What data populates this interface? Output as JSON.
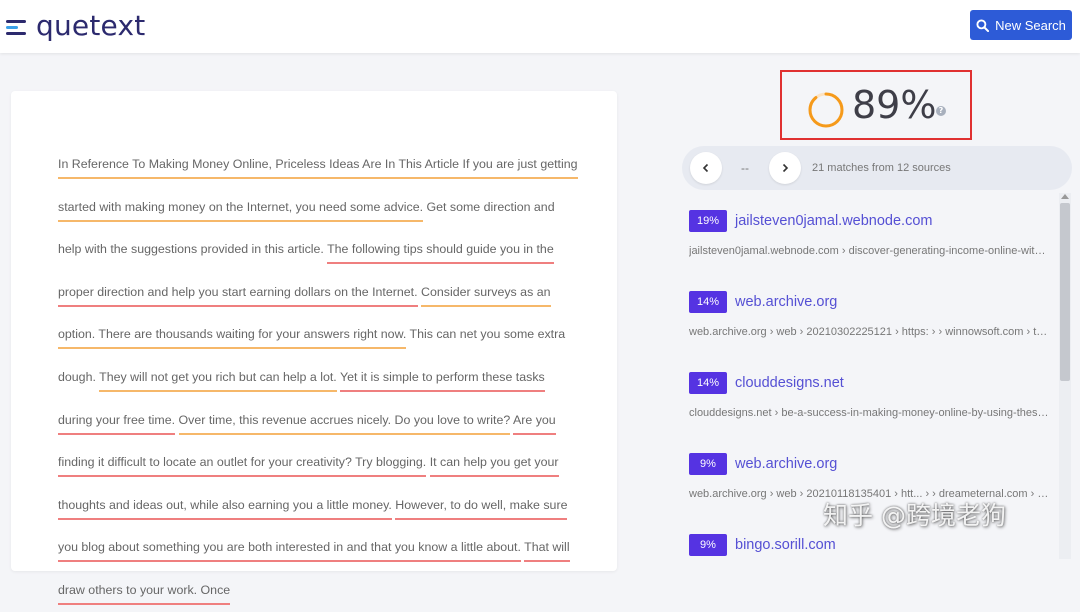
{
  "app": {
    "logo_text": "quetext",
    "new_search_label": "New Search"
  },
  "document": {
    "segments": [
      {
        "text": "In Reference To Making Money Online, Priceless Ideas Are In This Article If you are just getting started with making money on the Internet, you need some advice.",
        "match": "orange"
      },
      {
        "text": " Get some direction and help with the suggestions provided in this article. ",
        "match": "none"
      },
      {
        "text": "The following tips should guide you in the proper direction and help you start earning dollars on the Internet.",
        "match": "red"
      },
      {
        "text": " ",
        "match": "none"
      },
      {
        "text": "Consider surveys as an option. There are thousands waiting for your answers right now.",
        "match": "orange"
      },
      {
        "text": " This can net you some extra dough. ",
        "match": "none"
      },
      {
        "text": "They will not get you rich but can help a lot.",
        "match": "orange"
      },
      {
        "text": " ",
        "match": "none"
      },
      {
        "text": "Yet it is simple to perform these tasks during your free time.",
        "match": "red"
      },
      {
        "text": " ",
        "match": "none"
      },
      {
        "text": "Over time, this revenue accrues nicely. Do you love to write?",
        "match": "orange"
      },
      {
        "text": " ",
        "match": "none"
      },
      {
        "text": "Are you finding it difficult to locate an outlet for your creativity? Try blogging.",
        "match": "red"
      },
      {
        "text": " ",
        "match": "none"
      },
      {
        "text": "It can help you get your thoughts and ideas out, while also earning you a little money.",
        "match": "red"
      },
      {
        "text": " ",
        "match": "none"
      },
      {
        "text": "However, to do well, make sure you blog about something you are both interested in and that you know a little about.",
        "match": "red"
      },
      {
        "text": " ",
        "match": "none"
      },
      {
        "text": "That will draw others to your work. Once",
        "match": "red"
      }
    ]
  },
  "score": {
    "value": "89%",
    "fraction": 0.89,
    "help_icon": "?"
  },
  "navigation": {
    "position": "--",
    "matches_text": "21 matches from 12 sources"
  },
  "results": [
    {
      "percent": "19%",
      "title": "jailsteven0jamal.webnode.com",
      "path": "jailsteven0jamal.webnode.com › discover-generating-income-online-with-thi..."
    },
    {
      "percent": "14%",
      "title": "web.archive.org",
      "path": "web.archive.org › web › 20210302225121 › https: › › winnowsoft.com › tag..."
    },
    {
      "percent": "14%",
      "title": "clouddesigns.net",
      "path": "clouddesigns.net › be-a-success-in-making-money-online-by-using-these-id..."
    },
    {
      "percent": "9%",
      "title": "web.archive.org",
      "path": "web.archive.org › web › 20210118135401 › htt... › › dreameternal.com › tag..."
    },
    {
      "percent": "9%",
      "title": "bingo.sorill.com",
      "path": ""
    }
  ],
  "watermark": "知乎 @跨境老狗",
  "colors": {
    "brand_navy": "#2c2a6e",
    "button_blue": "#2d5bd7",
    "badge_purple": "#5533e2",
    "link_purple": "#5550d4",
    "match_orange": "#f6b86a",
    "match_red": "#ef7f7f",
    "score_ring": "#f59a1b",
    "highlight_box": "#e03131"
  }
}
